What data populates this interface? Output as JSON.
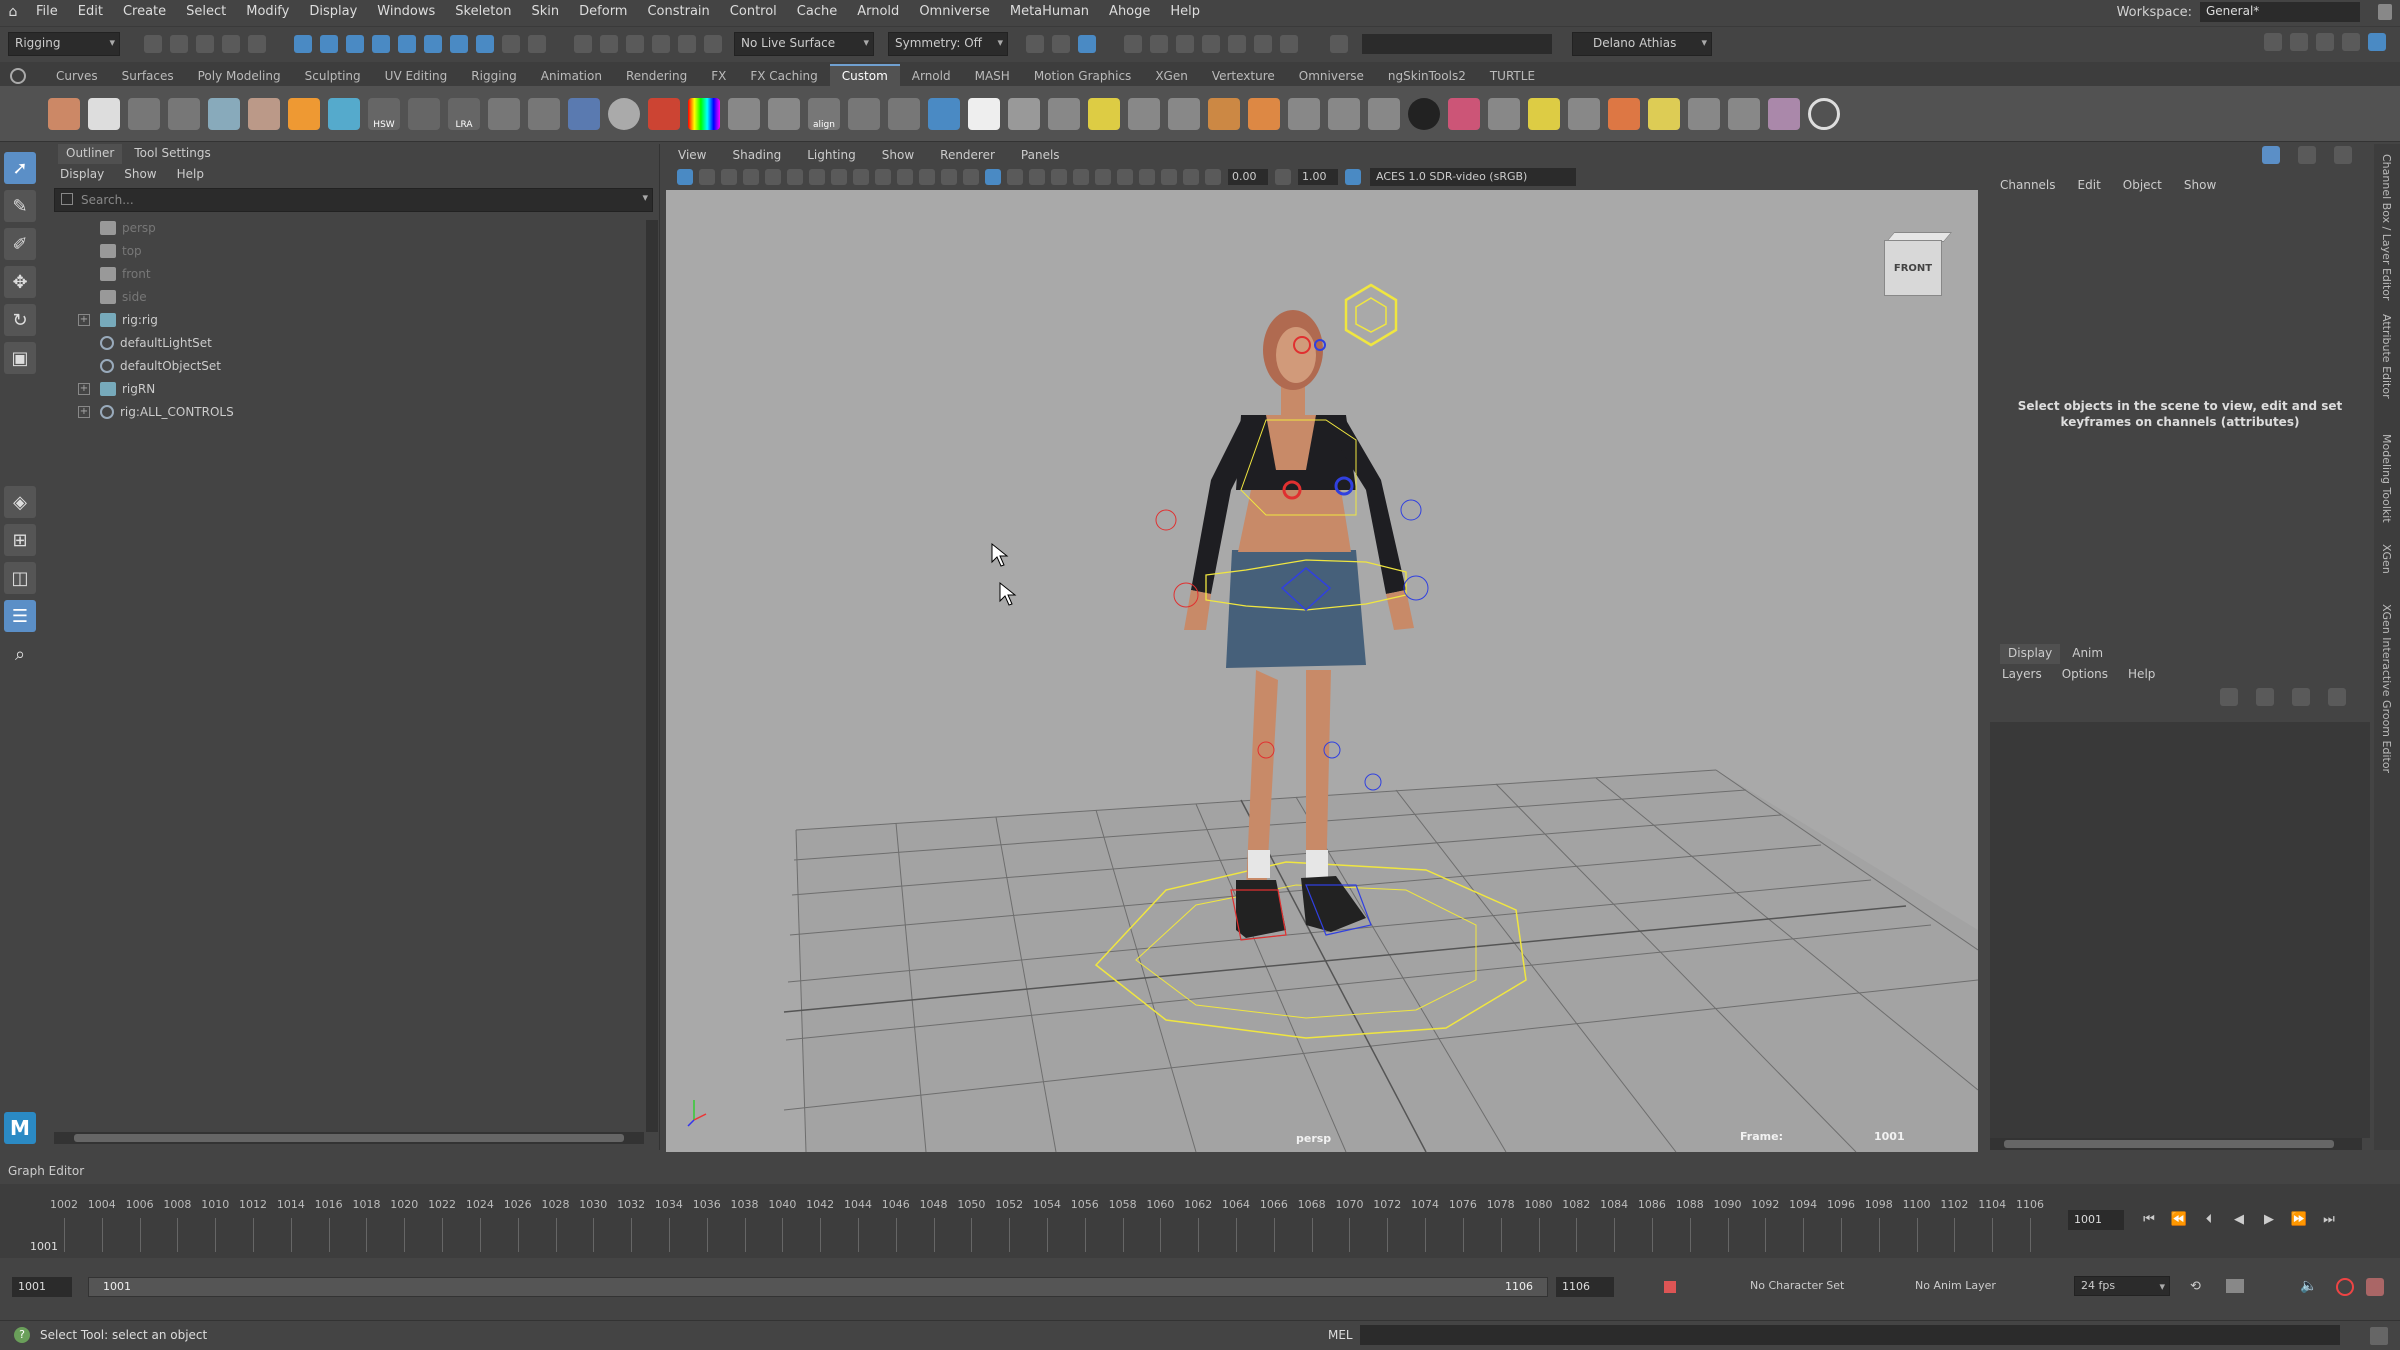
{
  "menubar": {
    "items": [
      "File",
      "Edit",
      "Create",
      "Select",
      "Modify",
      "Display",
      "Windows",
      "Skeleton",
      "Skin",
      "Deform",
      "Constrain",
      "Control",
      "Cache",
      "Arnold",
      "Omniverse",
      "MetaHuman",
      "Ahoge",
      "Help"
    ],
    "workspace_label": "Workspace:",
    "workspace_value": "General*"
  },
  "statusline": {
    "mode": "Rigging",
    "live_surface": "No Live Surface",
    "symmetry": "Symmetry: Off",
    "user": "Delano Athias"
  },
  "shelf": {
    "tabs": [
      "Curves",
      "Surfaces",
      "Poly Modeling",
      "Sculpting",
      "UV Editing",
      "Rigging",
      "Animation",
      "Rendering",
      "FX",
      "FX Caching",
      "Custom",
      "Arnold",
      "MASH",
      "Motion Graphics",
      "XGen",
      "Vertexture",
      "Omniverse",
      "ngSkinTools2",
      "TURTLE"
    ],
    "active_tab": "Custom",
    "icon_labels": {
      "hsw": "HSW",
      "lra": "LRA",
      "align": "align"
    }
  },
  "outliner": {
    "tabs": [
      "Outliner",
      "Tool Settings"
    ],
    "menu": [
      "Display",
      "Show",
      "Help"
    ],
    "search_placeholder": "Search...",
    "items": [
      {
        "label": "persp",
        "icon": "camera-icon",
        "expand": false,
        "dim": true
      },
      {
        "label": "top",
        "icon": "camera-icon",
        "expand": false,
        "dim": true
      },
      {
        "label": "front",
        "icon": "camera-icon",
        "expand": false,
        "dim": true
      },
      {
        "label": "side",
        "icon": "camera-icon",
        "expand": false,
        "dim": true
      },
      {
        "label": "rig:rig",
        "icon": "rig-icon",
        "expand": true,
        "dim": false
      },
      {
        "label": "defaultLightSet",
        "icon": "set-icon",
        "expand": false,
        "dim": false
      },
      {
        "label": "defaultObjectSet",
        "icon": "set-icon",
        "expand": false,
        "dim": false
      },
      {
        "label": "rigRN",
        "icon": "reference-icon",
        "expand": true,
        "dim": false
      },
      {
        "label": "rig:ALL_CONTROLS",
        "icon": "set-icon",
        "expand": true,
        "dim": false
      }
    ]
  },
  "viewport": {
    "menu": [
      "View",
      "Shading",
      "Lighting",
      "Show",
      "Renderer",
      "Panels"
    ],
    "exposure": "0.00",
    "gamma": "1.00",
    "colorspace": "ACES 1.0 SDR-video (sRGB)",
    "camera_label": "persp",
    "frame_label": "Frame:",
    "frame_value": "1001",
    "viewcube_label": "FRONT"
  },
  "channelbox": {
    "menu": [
      "Channels",
      "Edit",
      "Object",
      "Show"
    ],
    "message": "Select objects in the scene to view, edit and set keyframes on channels (attributes)",
    "layer_tabs": [
      "Display",
      "Anim"
    ],
    "layer_menu": [
      "Layers",
      "Options",
      "Help"
    ]
  },
  "side_tabs": [
    "Channel Box / Layer Editor",
    "Attribute Editor",
    "Modeling Toolkit",
    "XGen",
    "XGen Interactive Groom Editor"
  ],
  "graph_editor_label": "Graph Editor",
  "timeline": {
    "ticks": [
      "1002",
      "1004",
      "1006",
      "1008",
      "1010",
      "1012",
      "1014",
      "1016",
      "1018",
      "1020",
      "1022",
      "1024",
      "1026",
      "1028",
      "1030",
      "1032",
      "1034",
      "1036",
      "1038",
      "1040",
      "1042",
      "1044",
      "1046",
      "1048",
      "1050",
      "1052",
      "1054",
      "1056",
      "1058",
      "1060",
      "1062",
      "1064",
      "1066",
      "1068",
      "1070",
      "1072",
      "1074",
      "1076",
      "1078",
      "1080",
      "1082",
      "1084",
      "1086",
      "1088",
      "1090",
      "1092",
      "1094",
      "1096",
      "1098",
      "1100",
      "1102",
      "1104",
      "1106"
    ],
    "current_frame": "1001",
    "current_field": "1001"
  },
  "range": {
    "start": "1001",
    "slider_start": "1001",
    "slider_end": "1106",
    "end": "1106",
    "character_set": "No Character Set",
    "anim_layer": "No Anim Layer",
    "fps": "24 fps"
  },
  "cmdline": {
    "help_text": "Select Tool: select an object",
    "mel_label": "MEL"
  },
  "colors": {
    "accent": "#5b8fc7",
    "viewport_bg": "#a9a9a9",
    "control_yellow": "#f0e640",
    "control_red": "#e03030",
    "control_blue": "#3040e0"
  }
}
